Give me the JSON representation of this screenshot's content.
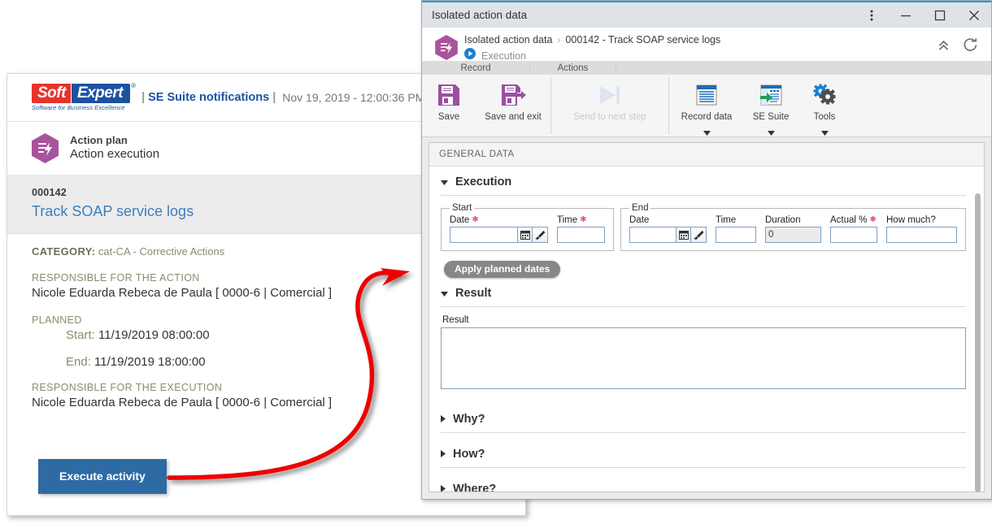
{
  "notification_panel": {
    "brand": {
      "soft": "Soft",
      "expert": "Expert",
      "registered": "®",
      "tagline": "Software for Business Excellence"
    },
    "header": {
      "separator_left": "|",
      "title": "SE Suite notifications",
      "separator_right": "|",
      "datetime": "Nov 19, 2019 - 12:00:36 PM"
    },
    "plan": {
      "icon": "action-plan-hex-icon",
      "kicker": "Action plan",
      "subtitle": "Action execution"
    },
    "record": {
      "id": "000142",
      "name": "Track SOAP service logs"
    },
    "category": {
      "label": "CATEGORY:",
      "value": "cat-CA - Corrective Actions"
    },
    "responsible_action": {
      "label": "RESPONSIBLE FOR THE ACTION",
      "value": "Nicole Eduarda Rebeca de Paula [ 0000-6 | Comercial ]"
    },
    "planned": {
      "label": "PLANNED",
      "start_label": "Start:",
      "start_value": "11/19/2019 08:00:00",
      "end_label": "End:",
      "end_value": "11/19/2019 18:00:00"
    },
    "responsible_execution": {
      "label": "RESPONSIBLE FOR THE EXECUTION",
      "value": "Nicole Eduarda Rebeca de Paula [ 0000-6 | Comercial ]"
    },
    "execute_button": "Execute activity"
  },
  "annotation": {
    "arrow_color": "#ee0000",
    "arrow_name": "red-curved-arrow"
  },
  "window": {
    "title": "Isolated action data",
    "controls": {
      "more": "more-options-icon",
      "minimize": "minimize-icon",
      "maximize": "maximize-icon",
      "close": "close-icon"
    },
    "breadcrumb": {
      "icon": "action-plan-hex-icon",
      "root": "Isolated action data",
      "separator": "›",
      "current": "000142 - Track SOAP service logs",
      "step_icon": "play-circle-icon",
      "step": "Execution",
      "collapse_icon": "chevron-double-up-icon",
      "refresh_icon": "refresh-icon"
    },
    "ribbon_tabs": [
      {
        "label": "Record"
      },
      {
        "label": "Actions"
      }
    ],
    "ribbon_buttons": [
      {
        "label": "Save",
        "icon": "save-floppy-icon",
        "disabled": false,
        "has_caret": false
      },
      {
        "label": "Save and exit",
        "icon": "save-and-exit-icon",
        "disabled": false,
        "has_caret": false
      },
      {
        "label": "Send to next step",
        "icon": "send-next-step-icon",
        "disabled": true,
        "has_caret": false
      },
      {
        "label": "Record data",
        "icon": "record-data-icon",
        "disabled": false,
        "has_caret": true
      },
      {
        "label": "SE Suite",
        "icon": "se-suite-icon",
        "disabled": false,
        "has_caret": true
      },
      {
        "label": "Tools",
        "icon": "tools-gears-icon",
        "disabled": false,
        "has_caret": true
      }
    ],
    "general_data_label": "GENERAL DATA",
    "sections": {
      "execution": {
        "title": "Execution",
        "expanded": true,
        "start_legend": "Start",
        "end_legend": "End",
        "fields": {
          "start_date_label": "Date",
          "start_date_required": true,
          "start_date_value": "",
          "start_time_label": "Time",
          "start_time_required": true,
          "start_time_value": "",
          "end_date_label": "Date",
          "end_date_required": false,
          "end_date_value": "",
          "end_time_label": "Time",
          "end_time_required": false,
          "end_time_value": "",
          "duration_label": "Duration",
          "duration_value": "0",
          "actual_label": "Actual %",
          "actual_required": true,
          "actual_value": "",
          "how_much_label": "How much?",
          "how_much_value": ""
        },
        "calendar_icon": "calendar-icon",
        "clear_icon": "eraser-brush-icon",
        "apply_button": "Apply planned dates"
      },
      "result": {
        "title": "Result",
        "expanded": true,
        "field_label": "Result",
        "field_value": ""
      },
      "why": {
        "title": "Why?",
        "expanded": false
      },
      "how": {
        "title": "How?",
        "expanded": false
      },
      "where": {
        "title": "Where?",
        "expanded": false
      }
    }
  },
  "colors": {
    "brand_red": "#e8322a",
    "brand_blue": "#1b52a0",
    "hex_purple": "#a9539c",
    "link_blue": "#3a7fbd",
    "button_blue": "#2e6ba4",
    "arrow_red": "#ee0000",
    "title_accent": "#1a9bed",
    "required_red": "#d0021b"
  }
}
